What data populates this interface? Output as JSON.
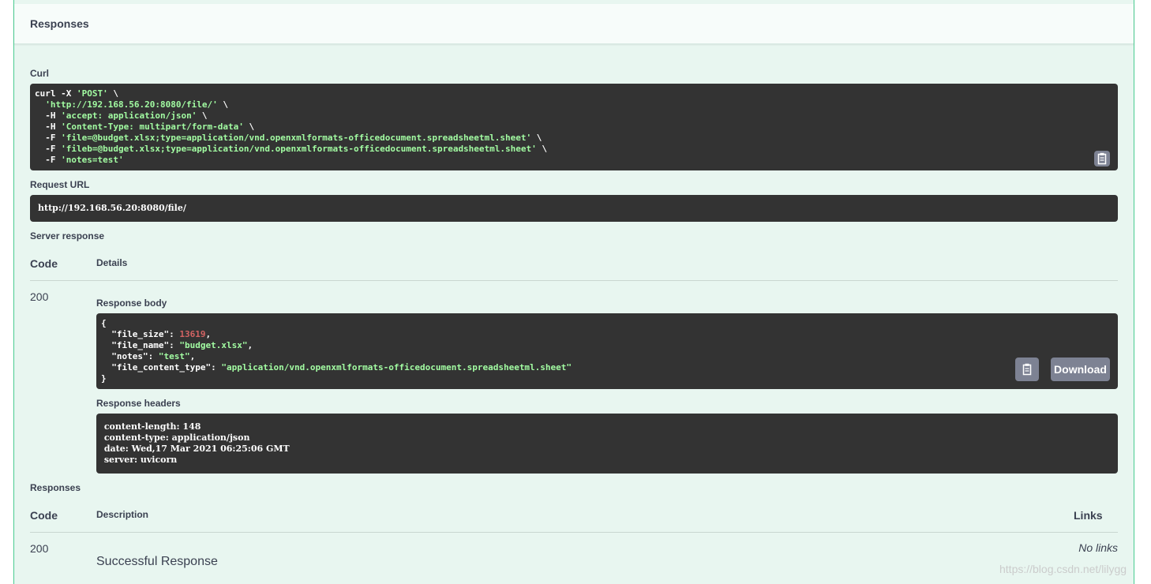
{
  "header": {
    "title": "Responses"
  },
  "curl": {
    "label": "Curl",
    "lines": [
      [
        {
          "t": "curl -X ",
          "c": "plain"
        },
        {
          "t": "'POST'",
          "c": "str"
        },
        {
          "t": " \\",
          "c": "plain"
        }
      ],
      [
        {
          "t": "  ",
          "c": "plain"
        },
        {
          "t": "'http://192.168.56.20:8080/file/'",
          "c": "str"
        },
        {
          "t": " \\",
          "c": "plain"
        }
      ],
      [
        {
          "t": "  -H ",
          "c": "plain"
        },
        {
          "t": "'accept: application/json'",
          "c": "str"
        },
        {
          "t": " \\",
          "c": "plain"
        }
      ],
      [
        {
          "t": "  -H ",
          "c": "plain"
        },
        {
          "t": "'Content-Type: multipart/form-data'",
          "c": "str"
        },
        {
          "t": " \\",
          "c": "plain"
        }
      ],
      [
        {
          "t": "  -F ",
          "c": "plain"
        },
        {
          "t": "'file=@budget.xlsx;type=application/vnd.openxmlformats-officedocument.spreadsheetml.sheet'",
          "c": "str"
        },
        {
          "t": " \\",
          "c": "plain"
        }
      ],
      [
        {
          "t": "  -F ",
          "c": "plain"
        },
        {
          "t": "'fileb=@budget.xlsx;type=application/vnd.openxmlformats-officedocument.spreadsheetml.sheet'",
          "c": "str"
        },
        {
          "t": " \\",
          "c": "plain"
        }
      ],
      [
        {
          "t": "  -F ",
          "c": "plain"
        },
        {
          "t": "'notes=test'",
          "c": "str"
        }
      ]
    ],
    "copy_icon": "clipboard-icon"
  },
  "request_url": {
    "label": "Request URL",
    "value": "http://192.168.56.20:8080/file/"
  },
  "server_response": {
    "label": "Server response",
    "code_header": "Code",
    "details_header": "Details",
    "code": "200",
    "body_label": "Response body",
    "body_lines": [
      [
        {
          "t": "{",
          "c": "plain"
        }
      ],
      [
        {
          "t": "  \"file_size\": ",
          "c": "plain"
        },
        {
          "t": "13619",
          "c": "num"
        },
        {
          "t": ",",
          "c": "plain"
        }
      ],
      [
        {
          "t": "  \"file_name\": ",
          "c": "plain"
        },
        {
          "t": "\"budget.xlsx\"",
          "c": "str"
        },
        {
          "t": ",",
          "c": "plain"
        }
      ],
      [
        {
          "t": "  \"notes\": ",
          "c": "plain"
        },
        {
          "t": "\"test\"",
          "c": "str"
        },
        {
          "t": ",",
          "c": "plain"
        }
      ],
      [
        {
          "t": "  \"file_content_type\": ",
          "c": "plain"
        },
        {
          "t": "\"application/vnd.openxmlformats-officedocument.spreadsheetml.sheet\"",
          "c": "str"
        }
      ],
      [
        {
          "t": "}",
          "c": "plain"
        }
      ]
    ],
    "download_label": "Download",
    "headers_label": "Response headers",
    "headers_lines": [
      " content-length: 148 ",
      " content-type: application/json ",
      " date: Wed,17 Mar 2021 06:25:06 GMT ",
      " server: uvicorn "
    ]
  },
  "responses": {
    "label": "Responses",
    "code_header": "Code",
    "description_header": "Description",
    "links_header": "Links",
    "rows": [
      {
        "code": "200",
        "description": "Successful Response",
        "links": "No links"
      }
    ]
  },
  "watermark": "https://blog.csdn.net/lilygg"
}
